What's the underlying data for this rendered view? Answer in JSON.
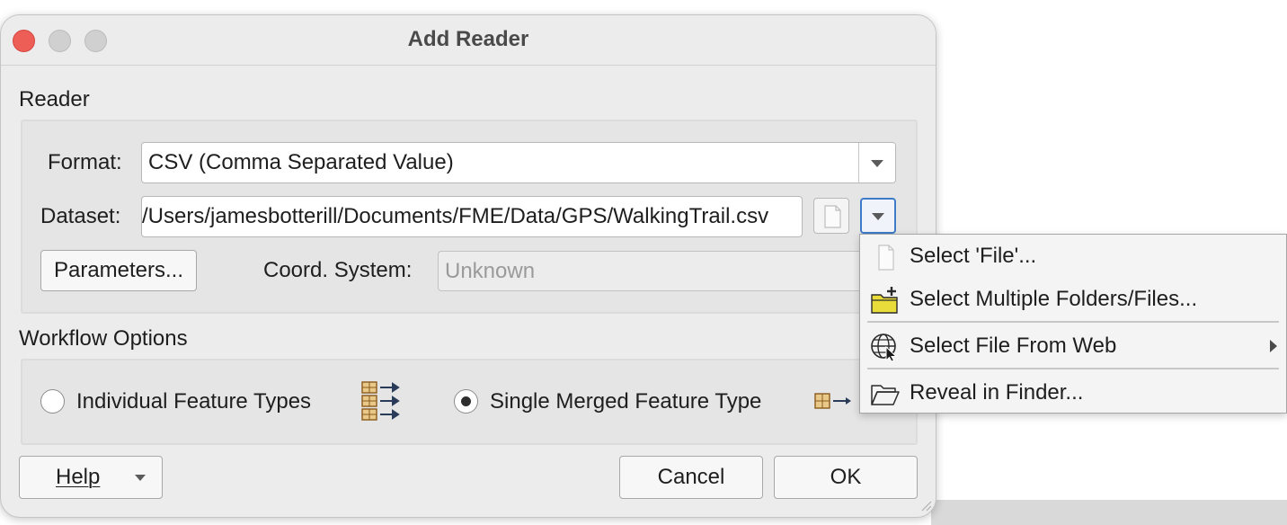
{
  "window": {
    "title": "Add Reader"
  },
  "reader_section": {
    "label": "Reader",
    "format_label": "Format:",
    "format_value": "CSV (Comma Separated Value)",
    "dataset_label": "Dataset:",
    "dataset_value": "/Users/jamesbotterill/Documents/FME/Data/GPS/WalkingTrail.csv",
    "parameters_button": "Parameters...",
    "coord_label": "Coord. System:",
    "coord_value": "Unknown"
  },
  "workflow_section": {
    "label": "Workflow Options",
    "individual_label": "Individual Feature Types",
    "merged_label": "Single Merged Feature Type",
    "selected": "Single Merged Feature Type"
  },
  "buttons": {
    "help": "Help",
    "cancel": "Cancel",
    "ok": "OK"
  },
  "dataset_menu": {
    "items": [
      {
        "label": "Select 'File'...",
        "icon": "blank-file-icon"
      },
      {
        "label": "Select Multiple Folders/Files...",
        "icon": "folder-add-icon"
      },
      {
        "label": "Select File From Web",
        "icon": "globe-cursor-icon",
        "has_submenu": true
      },
      {
        "label": "Reveal in Finder...",
        "icon": "folder-open-icon"
      }
    ]
  },
  "colors": {
    "close_button": "#ed5e57",
    "focus_accent": "#3e7bc8",
    "folder_yellow": "#e8dc3a"
  }
}
